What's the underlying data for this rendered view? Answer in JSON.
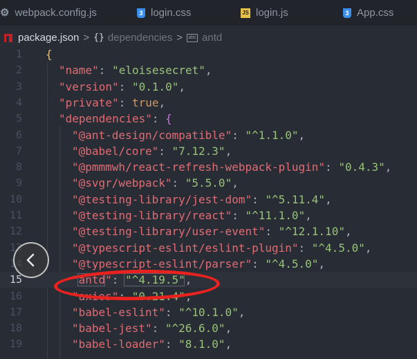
{
  "tabs": [
    {
      "label": "webpack.config.js",
      "icon": "gear-icon"
    },
    {
      "label": "login.css",
      "icon": "css3-icon"
    },
    {
      "label": "login.js",
      "icon": "js-icon"
    },
    {
      "label": "App.css",
      "icon": "css3-icon"
    }
  ],
  "breadcrumb": {
    "file": "package.json",
    "node": "dependencies",
    "leaf": "antd",
    "braces": "{}",
    "sep": ">",
    "abc": "abc"
  },
  "editor": {
    "current_line": 15,
    "lines": [
      {
        "n": "1",
        "parts": [
          [
            "br1",
            "{"
          ]
        ]
      },
      {
        "n": "2",
        "parts": [
          [
            "k",
            "\"name\""
          ],
          [
            "p",
            ": "
          ],
          [
            "s",
            "\"eloisesecret\""
          ],
          [
            "p",
            ","
          ]
        ]
      },
      {
        "n": "3",
        "parts": [
          [
            "k",
            "\"version\""
          ],
          [
            "p",
            ": "
          ],
          [
            "s",
            "\"0.1.0\""
          ],
          [
            "p",
            ","
          ]
        ]
      },
      {
        "n": "4",
        "parts": [
          [
            "k",
            "\"private\""
          ],
          [
            "p",
            ": "
          ],
          [
            "b",
            "true"
          ],
          [
            "p",
            ","
          ]
        ]
      },
      {
        "n": "5",
        "parts": [
          [
            "k",
            "\"dependencies\""
          ],
          [
            "p",
            ": "
          ],
          [
            "br2",
            "{"
          ]
        ]
      },
      {
        "n": "6",
        "parts": [
          [
            "k",
            "\"@ant-design/compatible\""
          ],
          [
            "p",
            ": "
          ],
          [
            "s",
            "\"^1.1.0\""
          ],
          [
            "p",
            ","
          ]
        ]
      },
      {
        "n": "7",
        "parts": [
          [
            "k",
            "\"@babel/core\""
          ],
          [
            "p",
            ": "
          ],
          [
            "s",
            "\"7.12.3\""
          ],
          [
            "p",
            ","
          ]
        ]
      },
      {
        "n": "8",
        "parts": [
          [
            "k",
            "\"@pmmmwh/react-refresh-webpack-plugin\""
          ],
          [
            "p",
            ": "
          ],
          [
            "s",
            "\"0.4.3\""
          ],
          [
            "p",
            ","
          ]
        ]
      },
      {
        "n": "9",
        "parts": [
          [
            "k",
            "\"@svgr/webpack\""
          ],
          [
            "p",
            ": "
          ],
          [
            "s",
            "\"5.5.0\""
          ],
          [
            "p",
            ","
          ]
        ]
      },
      {
        "n": "10",
        "parts": [
          [
            "k",
            "\"@testing-library/jest-dom\""
          ],
          [
            "p",
            ": "
          ],
          [
            "s",
            "\"^5.11.4\""
          ],
          [
            "p",
            ","
          ]
        ]
      },
      {
        "n": "11",
        "parts": [
          [
            "k",
            "\"@testing-library/react\""
          ],
          [
            "p",
            ": "
          ],
          [
            "s",
            "\"^11.1.0\""
          ],
          [
            "p",
            ","
          ]
        ]
      },
      {
        "n": "12",
        "parts": [
          [
            "k",
            "\"@testing-library/user-event\""
          ],
          [
            "p",
            ": "
          ],
          [
            "s",
            "\"^12.1.10\""
          ],
          [
            "p",
            ","
          ]
        ]
      },
      {
        "n": "13",
        "parts": [
          [
            "k",
            "\"@typescript-eslint/eslint-plugin\""
          ],
          [
            "p",
            ": "
          ],
          [
            "s",
            "\"^4.5.0\""
          ],
          [
            "p",
            ","
          ]
        ]
      },
      {
        "n": "14",
        "parts": [
          [
            "k",
            "\"@typescript-eslint/parser\""
          ],
          [
            "p",
            ": "
          ],
          [
            "s",
            "\"^4.5.0\""
          ],
          [
            "p",
            ","
          ]
        ]
      },
      {
        "n": "15",
        "parts": [
          [
            "k",
            "\"antd\""
          ],
          [
            "p",
            ": "
          ],
          [
            "s",
            "\"^4.19.5\""
          ],
          [
            "p",
            ","
          ]
        ]
      },
      {
        "n": "16",
        "parts": [
          [
            "k",
            "\"axios\""
          ],
          [
            "p",
            ": "
          ],
          [
            "s",
            "\"0.21.4\""
          ],
          [
            "p",
            ","
          ]
        ]
      },
      {
        "n": "17",
        "parts": [
          [
            "k",
            "\"babel-eslint\""
          ],
          [
            "p",
            ": "
          ],
          [
            "s",
            "\"^10.1.0\""
          ],
          [
            "p",
            ","
          ]
        ]
      },
      {
        "n": "18",
        "parts": [
          [
            "k",
            "\"babel-jest\""
          ],
          [
            "p",
            ": "
          ],
          [
            "s",
            "\"^26.6.0\""
          ],
          [
            "p",
            ","
          ]
        ]
      },
      {
        "n": "19",
        "parts": [
          [
            "k",
            "\"babel-loader\""
          ],
          [
            "p",
            ": "
          ],
          [
            "s",
            "\"8.1.0\""
          ],
          [
            "p",
            ","
          ]
        ]
      }
    ]
  },
  "colors": {
    "annotation": "#e8231f",
    "key": "#e06c75",
    "string": "#98c379",
    "boolean": "#d19a66"
  }
}
